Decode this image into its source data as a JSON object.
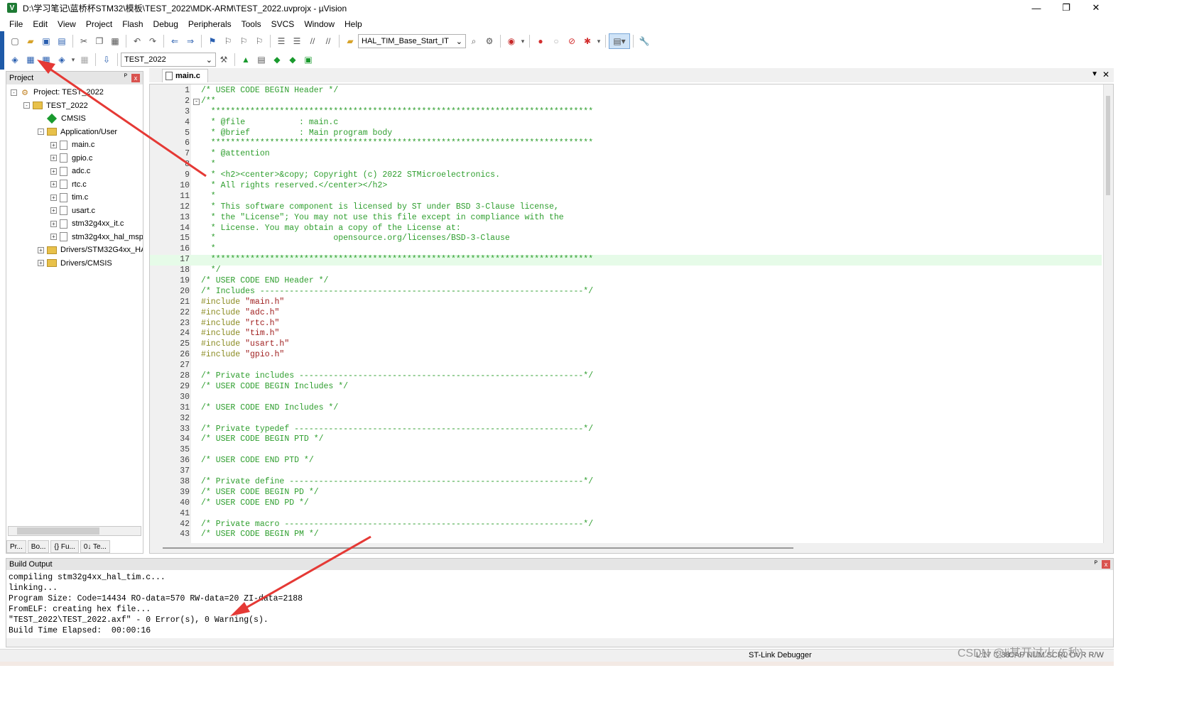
{
  "window": {
    "title": "D:\\学习笔记\\蓝桥杯STM32\\模板\\TEST_2022\\MDK-ARM\\TEST_2022.uvprojx - µVision",
    "app_icon_label": "V",
    "minimize": "—",
    "restore": "❐",
    "close": "✕"
  },
  "menu": [
    "File",
    "Edit",
    "View",
    "Project",
    "Flash",
    "Debug",
    "Peripherals",
    "Tools",
    "SVCS",
    "Window",
    "Help"
  ],
  "toolbar1": {
    "function_combo": "HAL_TIM_Base_Start_IT",
    "icons": [
      "new-file-icon",
      "open-icon",
      "save-icon",
      "save-all-icon",
      "cut-icon",
      "copy-icon",
      "paste-icon",
      "undo-icon",
      "redo-icon",
      "nav-back-icon",
      "nav-forward-icon",
      "bookmark-icon",
      "indent-icon",
      "outdent-icon",
      "comment-icon",
      "find-icon",
      "debug-start-icon",
      "breakpoint-icon",
      "window-icon",
      "wrench-icon"
    ]
  },
  "toolbar2": {
    "target_combo": "TEST_2022",
    "icons": [
      "translate-icon",
      "build-icon",
      "rebuild-icon",
      "batch-build-icon",
      "stop-build-icon",
      "download-icon",
      "options-icon",
      "manage-components-icon",
      "pack-installer-icon",
      "select-packs-icon"
    ]
  },
  "project_panel": {
    "title": "Project",
    "pin": "ᴾ",
    "close": "x",
    "tree": [
      {
        "label": "Project: TEST_2022",
        "type": "project",
        "level": 0,
        "exp": "-"
      },
      {
        "label": "TEST_2022",
        "type": "target",
        "level": 1,
        "exp": "-"
      },
      {
        "label": "CMSIS",
        "type": "diamond",
        "level": 2,
        "exp": ""
      },
      {
        "label": "Application/User",
        "type": "folder",
        "level": 2,
        "exp": "-"
      },
      {
        "label": "main.c",
        "type": "file",
        "level": 3,
        "exp": "+"
      },
      {
        "label": "gpio.c",
        "type": "file",
        "level": 3,
        "exp": "+"
      },
      {
        "label": "adc.c",
        "type": "file",
        "level": 3,
        "exp": "+"
      },
      {
        "label": "rtc.c",
        "type": "file",
        "level": 3,
        "exp": "+"
      },
      {
        "label": "tim.c",
        "type": "file",
        "level": 3,
        "exp": "+"
      },
      {
        "label": "usart.c",
        "type": "file",
        "level": 3,
        "exp": "+"
      },
      {
        "label": "stm32g4xx_it.c",
        "type": "file",
        "level": 3,
        "exp": "+"
      },
      {
        "label": "stm32g4xx_hal_msp",
        "type": "file",
        "level": 3,
        "exp": "+"
      },
      {
        "label": "Drivers/STM32G4xx_HA",
        "type": "folder",
        "level": 2,
        "exp": "+"
      },
      {
        "label": "Drivers/CMSIS",
        "type": "folder",
        "level": 2,
        "exp": "+"
      }
    ],
    "tabs": [
      "Pr...",
      "Bo...",
      "{} Fu...",
      "0↓ Te..."
    ]
  },
  "editor": {
    "tab": "main.c",
    "lines": [
      {
        "n": "1",
        "text": "/* USER CODE BEGIN Header */",
        "kind": "comment",
        "fold": ""
      },
      {
        "n": "2",
        "text": "/**",
        "kind": "comment",
        "fold": "-"
      },
      {
        "n": "3",
        "text": "  ******************************************************************************",
        "kind": "comment",
        "fold": ""
      },
      {
        "n": "4",
        "text": "  * @file           : main.c",
        "kind": "comment",
        "fold": ""
      },
      {
        "n": "5",
        "text": "  * @brief          : Main program body",
        "kind": "comment",
        "fold": ""
      },
      {
        "n": "6",
        "text": "  ******************************************************************************",
        "kind": "comment",
        "fold": ""
      },
      {
        "n": "7",
        "text": "  * @attention",
        "kind": "comment",
        "fold": ""
      },
      {
        "n": "8",
        "text": "  *",
        "kind": "comment",
        "fold": ""
      },
      {
        "n": "9",
        "text": "  * <h2><center>&copy; Copyright (c) 2022 STMicroelectronics.",
        "kind": "comment",
        "fold": ""
      },
      {
        "n": "10",
        "text": "  * All rights reserved.</center></h2>",
        "kind": "comment",
        "fold": ""
      },
      {
        "n": "11",
        "text": "  *",
        "kind": "comment",
        "fold": ""
      },
      {
        "n": "12",
        "text": "  * This software component is licensed by ST under BSD 3-Clause license,",
        "kind": "comment",
        "fold": ""
      },
      {
        "n": "13",
        "text": "  * the \"License\"; You may not use this file except in compliance with the",
        "kind": "comment",
        "fold": ""
      },
      {
        "n": "14",
        "text": "  * License. You may obtain a copy of the License at:",
        "kind": "comment",
        "fold": ""
      },
      {
        "n": "15",
        "text": "  *                        opensource.org/licenses/BSD-3-Clause",
        "kind": "comment",
        "fold": ""
      },
      {
        "n": "16",
        "text": "  *",
        "kind": "comment",
        "fold": ""
      },
      {
        "n": "17",
        "text": "  ******************************************************************************",
        "kind": "comment",
        "fold": "",
        "highlight": true
      },
      {
        "n": "18",
        "text": "  */",
        "kind": "comment",
        "fold": ""
      },
      {
        "n": "19",
        "text": "/* USER CODE END Header */",
        "kind": "comment",
        "fold": ""
      },
      {
        "n": "20",
        "text": "/* Includes ------------------------------------------------------------------*/",
        "kind": "comment",
        "fold": ""
      },
      {
        "n": "21",
        "pre": "#include ",
        "str": "\"main.h\"",
        "kind": "include",
        "fold": ""
      },
      {
        "n": "22",
        "pre": "#include ",
        "str": "\"adc.h\"",
        "kind": "include",
        "fold": ""
      },
      {
        "n": "23",
        "pre": "#include ",
        "str": "\"rtc.h\"",
        "kind": "include",
        "fold": ""
      },
      {
        "n": "24",
        "pre": "#include ",
        "str": "\"tim.h\"",
        "kind": "include",
        "fold": ""
      },
      {
        "n": "25",
        "pre": "#include ",
        "str": "\"usart.h\"",
        "kind": "include",
        "fold": ""
      },
      {
        "n": "26",
        "pre": "#include ",
        "str": "\"gpio.h\"",
        "kind": "include",
        "fold": ""
      },
      {
        "n": "27",
        "text": "",
        "kind": "comment",
        "fold": ""
      },
      {
        "n": "28",
        "text": "/* Private includes ----------------------------------------------------------*/",
        "kind": "comment",
        "fold": ""
      },
      {
        "n": "29",
        "text": "/* USER CODE BEGIN Includes */",
        "kind": "comment",
        "fold": ""
      },
      {
        "n": "30",
        "text": "",
        "kind": "comment",
        "fold": ""
      },
      {
        "n": "31",
        "text": "/* USER CODE END Includes */",
        "kind": "comment",
        "fold": ""
      },
      {
        "n": "32",
        "text": "",
        "kind": "comment",
        "fold": ""
      },
      {
        "n": "33",
        "text": "/* Private typedef -----------------------------------------------------------*/",
        "kind": "comment",
        "fold": ""
      },
      {
        "n": "34",
        "text": "/* USER CODE BEGIN PTD */",
        "kind": "comment",
        "fold": ""
      },
      {
        "n": "35",
        "text": "",
        "kind": "comment",
        "fold": ""
      },
      {
        "n": "36",
        "text": "/* USER CODE END PTD */",
        "kind": "comment",
        "fold": ""
      },
      {
        "n": "37",
        "text": "",
        "kind": "comment",
        "fold": ""
      },
      {
        "n": "38",
        "text": "/* Private define ------------------------------------------------------------*/",
        "kind": "comment",
        "fold": ""
      },
      {
        "n": "39",
        "text": "/* USER CODE BEGIN PD */",
        "kind": "comment",
        "fold": ""
      },
      {
        "n": "40",
        "text": "/* USER CODE END PD */",
        "kind": "comment",
        "fold": ""
      },
      {
        "n": "41",
        "text": "",
        "kind": "comment",
        "fold": ""
      },
      {
        "n": "42",
        "text": "/* Private macro -------------------------------------------------------------*/",
        "kind": "comment",
        "fold": ""
      },
      {
        "n": "43",
        "text": "/* USER CODE BEGIN PM */",
        "kind": "comment",
        "fold": ""
      }
    ]
  },
  "build_output": {
    "title": "Build Output",
    "lines": [
      "compiling stm32g4xx_hal_tim.c...",
      "linking...",
      "Program Size: Code=14434 RO-data=570 RW-data=20 ZI-data=2188",
      "FromELF: creating hex file...",
      "\"TEST_2022\\TEST_2022.axf\" - 0 Error(s), 0 Warning(s).",
      "Build Time Elapsed:  00:00:16"
    ]
  },
  "statusbar": {
    "debugger": "ST-Link Debugger",
    "position": "L:17 C:38",
    "caps": "CAP NUM SCRL OVR R/W"
  },
  "watermark": "CSDN @li某开过火 (5秒)",
  "colors": {
    "comment": "#2e9e2e",
    "preprocessor": "#8a8a20",
    "string": "#a02020",
    "line_highlight": "#e6fbe8",
    "annotation_arrow": "#e53935"
  }
}
